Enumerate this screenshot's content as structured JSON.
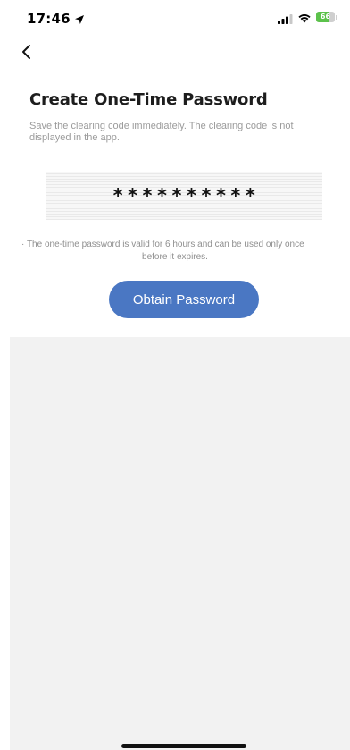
{
  "status_bar": {
    "time": "17:46",
    "location_icon": "location-arrow-icon",
    "signal_icon": "cellular-signal-icon",
    "wifi_icon": "wifi-icon",
    "battery_label": "66",
    "battery_level": 0.66,
    "battery_color": "#5cc24b"
  },
  "nav": {
    "back_icon": "chevron-left-icon"
  },
  "page": {
    "title": "Create One-Time Password",
    "subtitle": "Save the clearing code immediately. The clearing code is not displayed in the app.",
    "password_mask": "**********",
    "validity_note_line1": "The one-time password is valid for 6 hours and can be used only once",
    "validity_note_line2": "before it expires.",
    "obtain_button_label": "Obtain Password"
  },
  "colors": {
    "accent": "#4a77c3",
    "panel_background": "#f2f2f2"
  }
}
